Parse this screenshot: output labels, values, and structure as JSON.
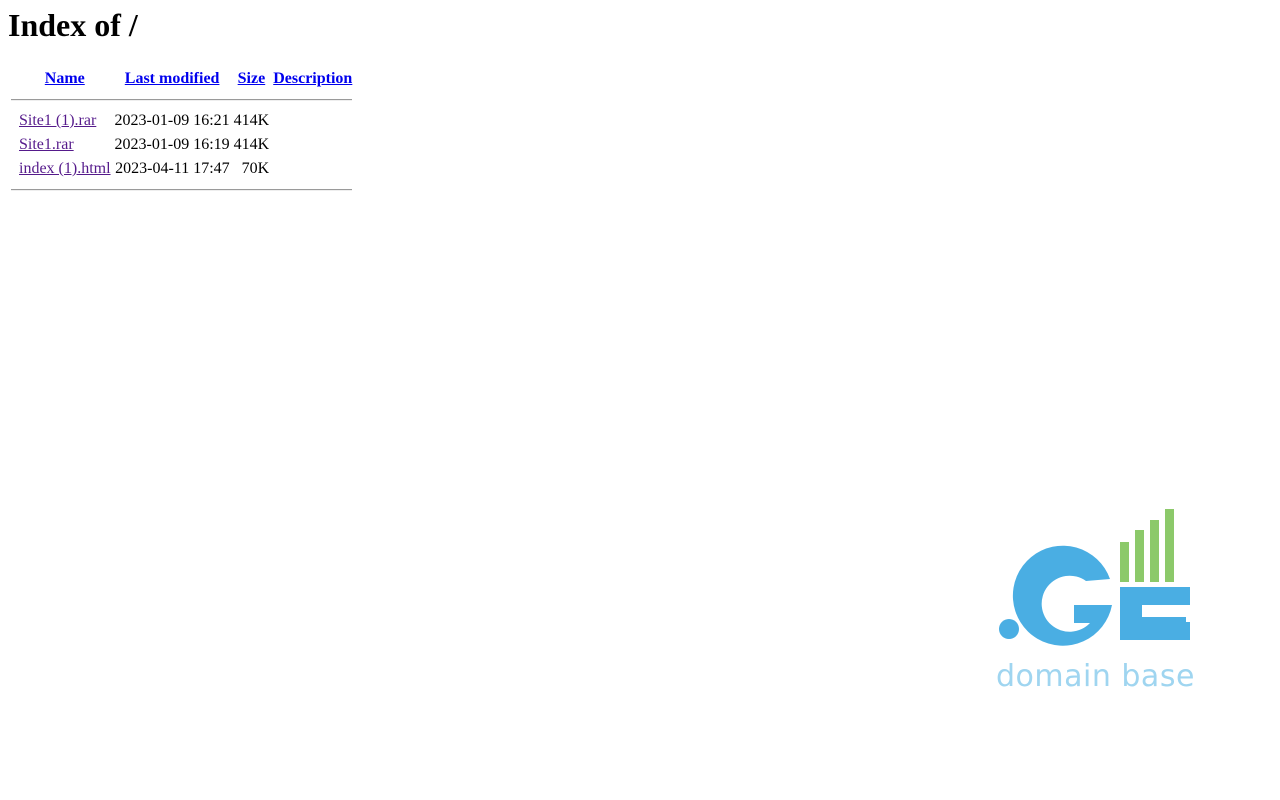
{
  "page": {
    "title": "Index of /"
  },
  "table": {
    "headers": {
      "name": "Name",
      "last_modified": "Last modified",
      "size": "Size",
      "description": "Description"
    },
    "rows": [
      {
        "name": "Site1 (1).rar",
        "last_modified": "2023-01-09 16:21",
        "size": "414K",
        "description": ""
      },
      {
        "name": "Site1.rar",
        "last_modified": "2023-01-09 16:19",
        "size": "414K",
        "description": ""
      },
      {
        "name": "index (1).html",
        "last_modified": "2023-04-11 17:47",
        "size": "70K",
        "description": ""
      }
    ]
  },
  "logo": {
    "text": "domain base",
    "brand_blue": "#4aaee3",
    "brand_green": "#8cc96a",
    "text_color": "#9fd5f0"
  }
}
